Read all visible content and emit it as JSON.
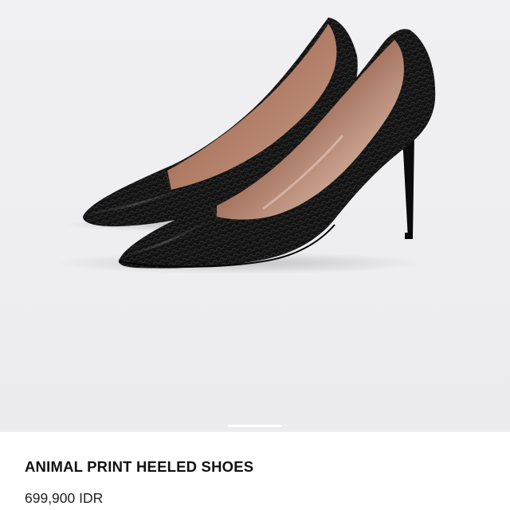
{
  "product": {
    "name": "ANIMAL PRINT HEELED SHOES",
    "price": "699,900 IDR",
    "image_subject": "black snakeskin pointed-toe stiletto pumps",
    "image_count_indicator": "carousel-active-page"
  },
  "colors": {
    "background": "#ffffff",
    "hero_background": "#efeff1",
    "shoe": "#141414",
    "lining": "#9a6a55",
    "text_primary": "#111111",
    "text_secondary": "#222222"
  }
}
